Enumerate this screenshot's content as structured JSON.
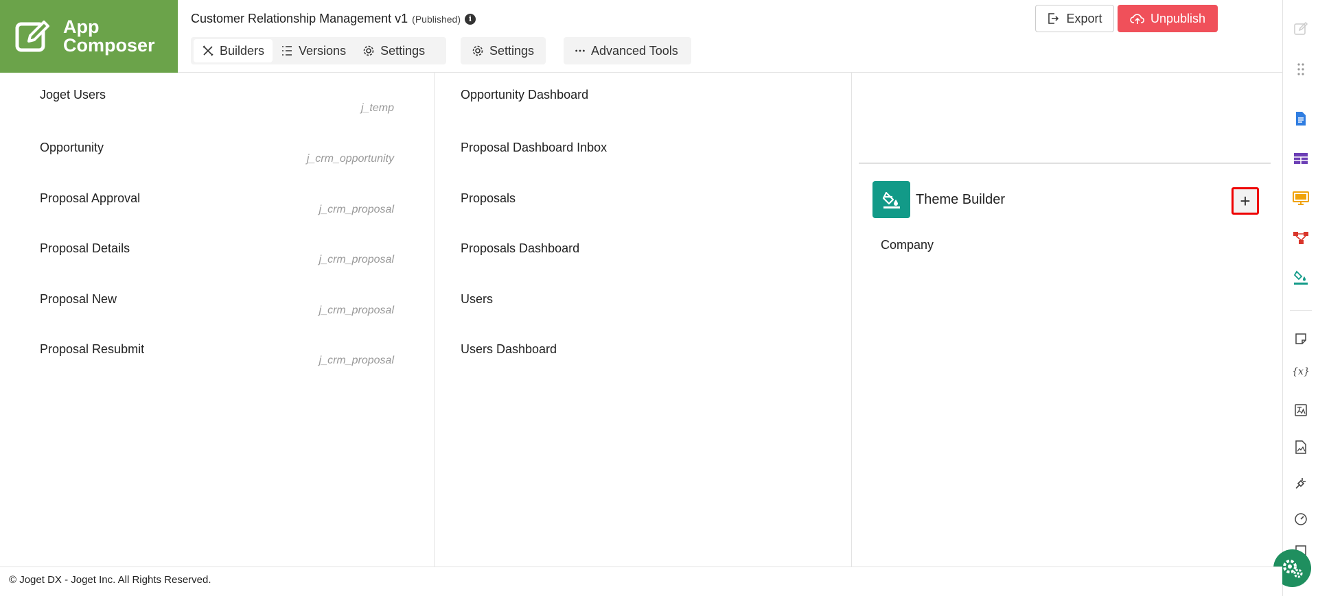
{
  "header": {
    "logo_text_line1": "App",
    "logo_text_line2": "Composer",
    "app_name": "Customer Relationship Management v1",
    "app_status": "(Published)",
    "tabs": [
      {
        "label": "Builders",
        "icon": "builders-icon",
        "active": true
      },
      {
        "label": "Versions",
        "icon": "list-icon",
        "active": false
      },
      {
        "label": "Settings",
        "icon": "gear-icon",
        "active": false
      }
    ],
    "settings_label": "Settings",
    "advanced_tools_label": "Advanced Tools",
    "export_label": "Export",
    "unpublish_label": "Unpublish"
  },
  "forms": [
    {
      "name": "Joget Users",
      "table": "j_temp"
    },
    {
      "name": "Opportunity",
      "table": "j_crm_opportunity"
    },
    {
      "name": "Proposal Approval",
      "table": "j_crm_proposal"
    },
    {
      "name": "Proposal Details",
      "table": "j_crm_proposal"
    },
    {
      "name": "Proposal New",
      "table": "j_crm_proposal"
    },
    {
      "name": "Proposal Resubmit",
      "table": "j_crm_proposal"
    }
  ],
  "lists": [
    {
      "name": "Opportunity Dashboard"
    },
    {
      "name": "Proposal Dashboard Inbox"
    },
    {
      "name": "Proposals"
    },
    {
      "name": "Proposals Dashboard"
    },
    {
      "name": "Users"
    },
    {
      "name": "Users Dashboard"
    }
  ],
  "theme_builder": {
    "title": "Theme Builder",
    "add_label": "+",
    "items": [
      "Company"
    ]
  },
  "footer": {
    "copyright": "© Joget DX - Joget Inc. All Rights Reserved."
  },
  "colors": {
    "brand_green": "#6ba34a",
    "unpublish_red": "#f0505a",
    "theme_teal": "#129a88"
  }
}
